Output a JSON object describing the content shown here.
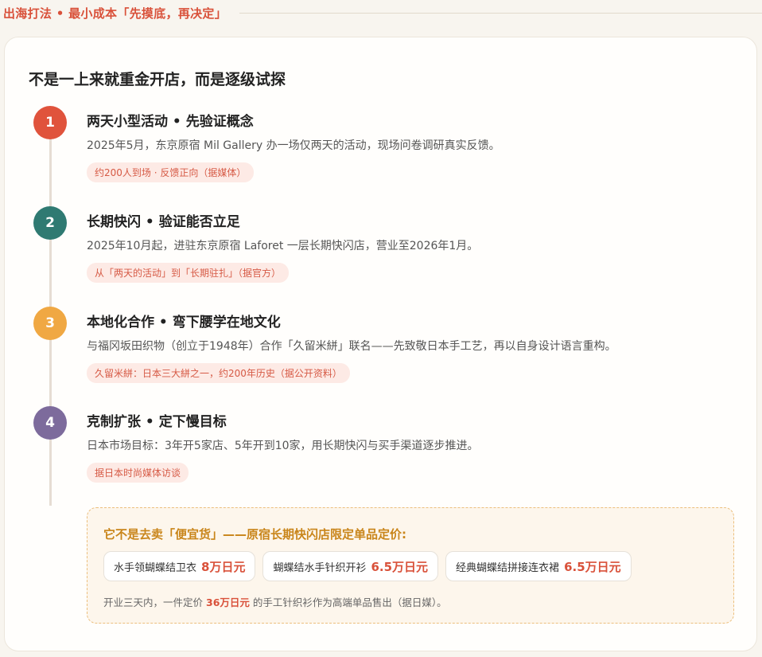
{
  "header": {
    "title": "出海打法 • 最小成本「先摸底，再决定」"
  },
  "card": {
    "title": "不是一上来就重金开店，而是逐级试探"
  },
  "steps": [
    {
      "num": "1",
      "color": "#e0533c",
      "title": "两天小型活动 • 先验证概念",
      "desc": "2025年5月，东京原宿 Mil Gallery 办一场仅两天的活动，现场问卷调研真实反馈。",
      "badge": "约200人到场 · 反馈正向（据媒体）"
    },
    {
      "num": "2",
      "color": "#2f7a72",
      "title": "长期快闪 • 验证能否立足",
      "desc": "2025年10月起，进驻东京原宿 Laforet 一层长期快闪店，营业至2026年1月。",
      "badge": "从「两天的活动」到「长期驻扎」（据官方）"
    },
    {
      "num": "3",
      "color": "#f0a843",
      "title": "本地化合作 • 弯下腰学在地文化",
      "desc": "与福冈坂田织物（创立于1948年）合作「久留米絣」联名——先致敬日本手工艺，再以自身设计语言重构。",
      "badge": "久留米絣：日本三大絣之一，约200年历史（据公开资料）"
    },
    {
      "num": "4",
      "color": "#7d6b9c",
      "title": "克制扩张 • 定下慢目标",
      "desc": "日本市场目标：3年开5家店、5年开到10家，用长期快闪与买手渠道逐步推进。",
      "badge": "据日本时尚媒体访谈"
    }
  ],
  "pricing": {
    "title": "它不是去卖「便宜货」——原宿长期快闪店限定单品定价:",
    "items": [
      {
        "name": "水手领蝴蝶结卫衣",
        "price": "8万日元"
      },
      {
        "name": "蝴蝶结水手针织开衫",
        "price": "6.5万日元"
      },
      {
        "name": "经典蝴蝶结拼接连衣裙",
        "price": "6.5万日元"
      }
    ],
    "note_prefix": "开业三天内，一件定价",
    "note_price": "36万日元",
    "note_suffix": "的手工针织衫作为高端单品售出（据日媒）。"
  }
}
